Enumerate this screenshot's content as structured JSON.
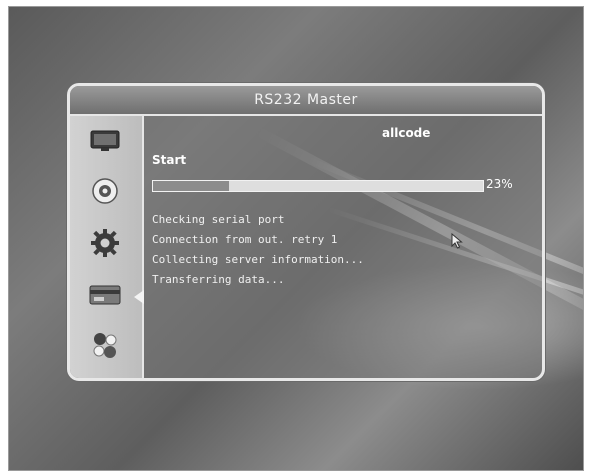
{
  "dialog": {
    "title": "RS232 Master"
  },
  "sidebar": {
    "items": [
      {
        "icon": "tv-icon",
        "active": false
      },
      {
        "icon": "disc-icon",
        "active": false
      },
      {
        "icon": "gear-icon",
        "active": false
      },
      {
        "icon": "card-icon",
        "active": true
      },
      {
        "icon": "tools-icon",
        "active": false
      }
    ]
  },
  "content": {
    "mode_label": "allcode",
    "status_label": "Start",
    "progress": {
      "percent_label": "23%",
      "fraction": 0.23
    },
    "log_lines": [
      "Checking serial port",
      "Connection from out. retry 1",
      "Collecting server information...",
      "Transferring data..."
    ]
  },
  "colors": {
    "sidebar_bg": "#c8c8c8",
    "title_bar": "#8a8a8a",
    "text": "#ffffff"
  }
}
